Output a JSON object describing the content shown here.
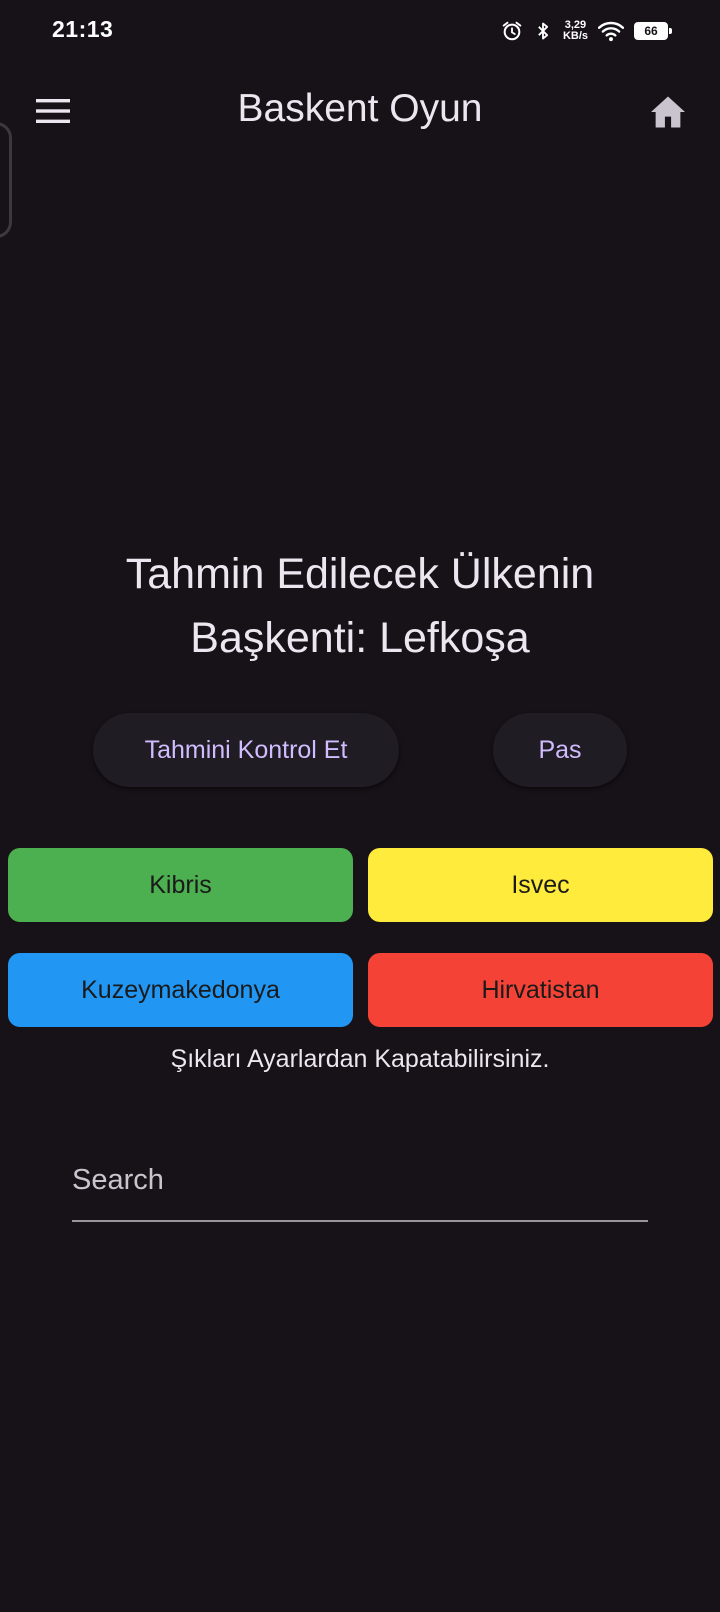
{
  "status_bar": {
    "time": "21:13",
    "net_speed_value": "3,29",
    "net_speed_unit": "KB/s",
    "battery": "66",
    "icons": [
      "alarm-icon",
      "bluetooth-icon",
      "wifi-icon",
      "battery-icon"
    ]
  },
  "app_bar": {
    "title": "Baskent Oyun",
    "menu_icon": "hamburger-menu-icon",
    "home_icon": "home-icon"
  },
  "question": {
    "line1": "Tahmin Edilecek Ülkenin",
    "line2": "Başkenti: Lefkoşa"
  },
  "actions": {
    "check_label": "Tahmini Kontrol Et",
    "pass_label": "Pas"
  },
  "options": [
    {
      "label": "Kibris",
      "color": "#4caf50"
    },
    {
      "label": "Isvec",
      "color": "#ffeb3b"
    },
    {
      "label": "Kuzeymakedonya",
      "color": "#2196f3"
    },
    {
      "label": "Hirvatistan",
      "color": "#f44336"
    }
  ],
  "hint": "Şıkları Ayarlardan Kapatabilirsiniz.",
  "search": {
    "placeholder": "Search",
    "value": ""
  },
  "colors": {
    "background": "#161218",
    "accent": "#d0bcfe",
    "pill_background": "#201c23"
  }
}
